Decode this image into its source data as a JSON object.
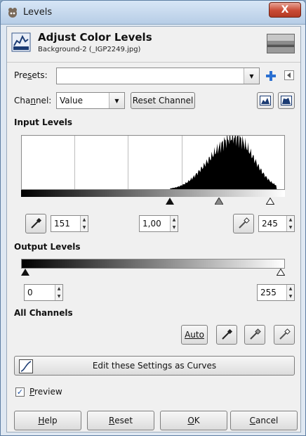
{
  "window": {
    "title": "Levels",
    "close_label": "X"
  },
  "header": {
    "title": "Adjust Color Levels",
    "subtitle": "Background-2 (_IGP2249.jpg)"
  },
  "presets": {
    "label": "Presets:",
    "value": ""
  },
  "channel": {
    "label": "Channel:",
    "value": "Value",
    "reset_label": "Reset Channel"
  },
  "input_levels": {
    "title": "Input Levels",
    "low": "151",
    "gamma": "1,00",
    "high": "245"
  },
  "output_levels": {
    "title": "Output Levels",
    "low": "0",
    "high": "255"
  },
  "all_channels": {
    "title": "All Channels",
    "auto_label": "Auto"
  },
  "curves_button": {
    "label": "Edit these Settings as Curves"
  },
  "preview": {
    "label": "Preview",
    "checked": true
  },
  "footer": {
    "help": "Help",
    "reset": "Reset",
    "ok": "OK",
    "cancel": "Cancel"
  },
  "colors": {
    "accent": "#1b63c5",
    "titlebar": "#b7cde6",
    "close": "#c94a34"
  },
  "histogram": {
    "peak_fraction": 0.9,
    "range_low": 151,
    "range_high": 245
  }
}
